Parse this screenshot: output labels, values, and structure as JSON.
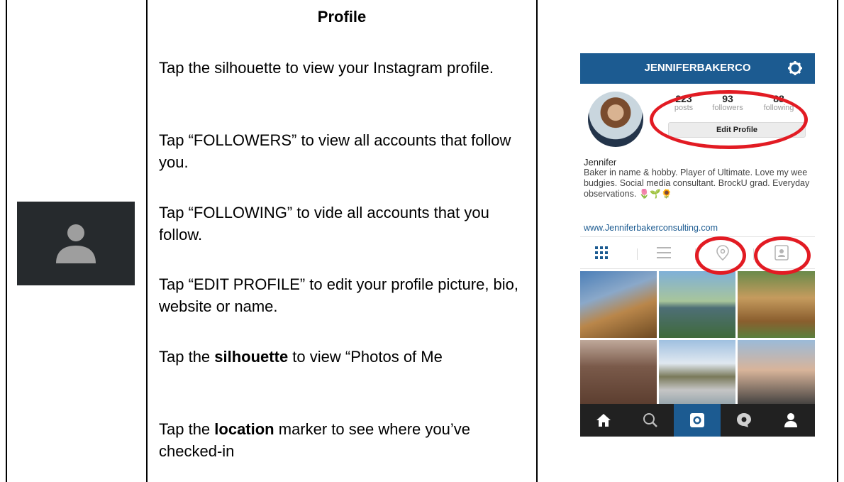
{
  "left_cell": {
    "icon": "person-silhouette-icon"
  },
  "middle": {
    "title": "Profile",
    "p1": "Tap the silhouette to view your Instagram profile.",
    "p2": "Tap “FOLLOWERS” to view all accounts that follow you.",
    "p3": "Tap “FOLLOWING” to vide all accounts that you follow.",
    "p4": "Tap “EDIT PROFILE” to edit your profile picture, bio, website or name.",
    "p5_pre": "Tap the ",
    "p5_bold": "silhouette",
    "p5_post": " to view “Photos of Me",
    "p6_pre": "Tap the ",
    "p6_bold": "location",
    "p6_post": " marker to see where you’ve checked-in"
  },
  "phone": {
    "header_title": "JENNIFERBAKERCO",
    "header_icon": "gear-icon",
    "stats": [
      {
        "num": "223",
        "label": "posts"
      },
      {
        "num": "93",
        "label": "followers"
      },
      {
        "num": "88",
        "label": "following"
      }
    ],
    "edit_profile": "Edit Profile",
    "name": "Jennifer",
    "bio": "Baker in name & hobby. Player of Ultimate. Love my wee budgies. Social media consultant. BrockU grad. Everyday observations. 🌷🌱🌻",
    "website": "www.Jenniferbakerconsulting.com",
    "tabs": [
      "grid-icon",
      "list-icon",
      "location-pin-icon",
      "photos-of-me-icon"
    ],
    "nav": [
      "home-icon",
      "search-icon",
      "camera-icon",
      "activity-icon",
      "profile-icon"
    ],
    "accent": "#1c5b91",
    "highlight": "#e21b23"
  }
}
